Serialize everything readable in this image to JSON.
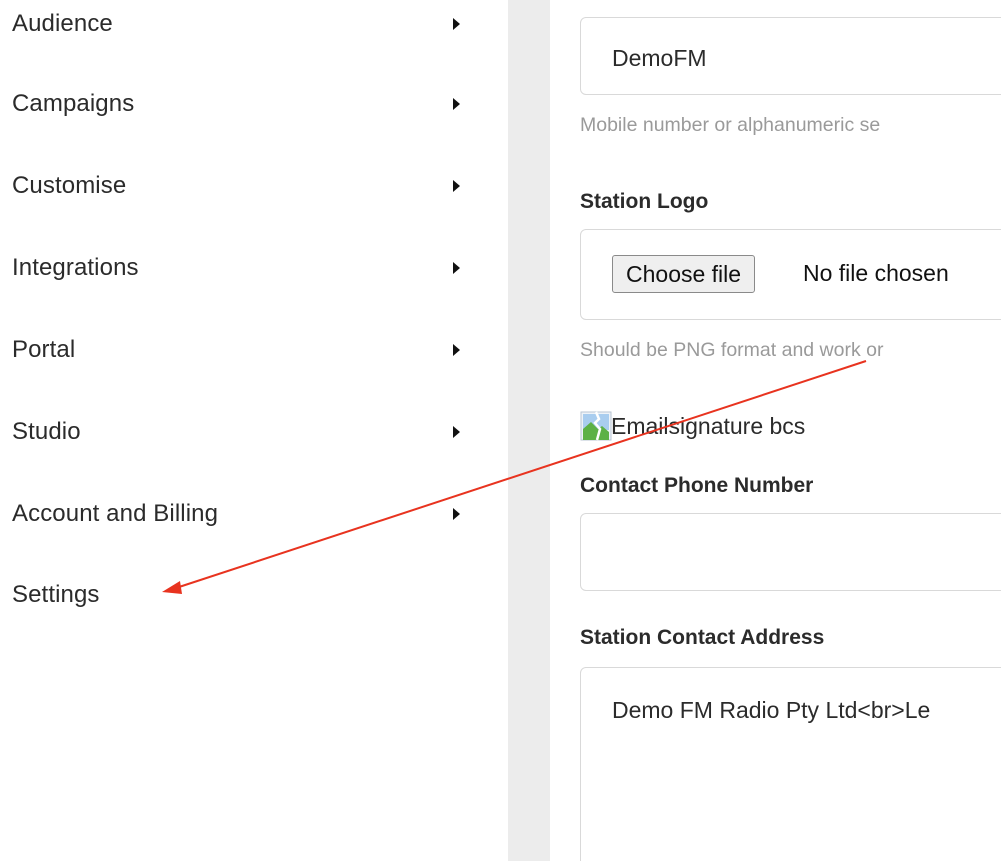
{
  "sidebar": {
    "items": [
      {
        "label": "Audience",
        "has_submenu": true
      },
      {
        "label": "Campaigns",
        "has_submenu": true
      },
      {
        "label": "Customise",
        "has_submenu": true
      },
      {
        "label": "Integrations",
        "has_submenu": true
      },
      {
        "label": "Portal",
        "has_submenu": true
      },
      {
        "label": "Studio",
        "has_submenu": true
      },
      {
        "label": "Account and Billing",
        "has_submenu": true
      },
      {
        "label": "Settings",
        "has_submenu": false
      }
    ]
  },
  "form": {
    "sender": {
      "value": "DemoFM",
      "help": "Mobile number or alphanumeric se"
    },
    "logo": {
      "label": "Station Logo",
      "button_label": "Choose file",
      "status": "No file chosen",
      "help": "Should be PNG format and work or",
      "image_alt": "Emailsignature bcs"
    },
    "phone": {
      "label": "Contact Phone Number",
      "value": ""
    },
    "address": {
      "label": "Station Contact Address",
      "value": "Demo FM Radio Pty Ltd<br>Le"
    }
  },
  "annotation": {
    "type": "arrow",
    "color": "#e8331f",
    "points_to": "Settings"
  }
}
